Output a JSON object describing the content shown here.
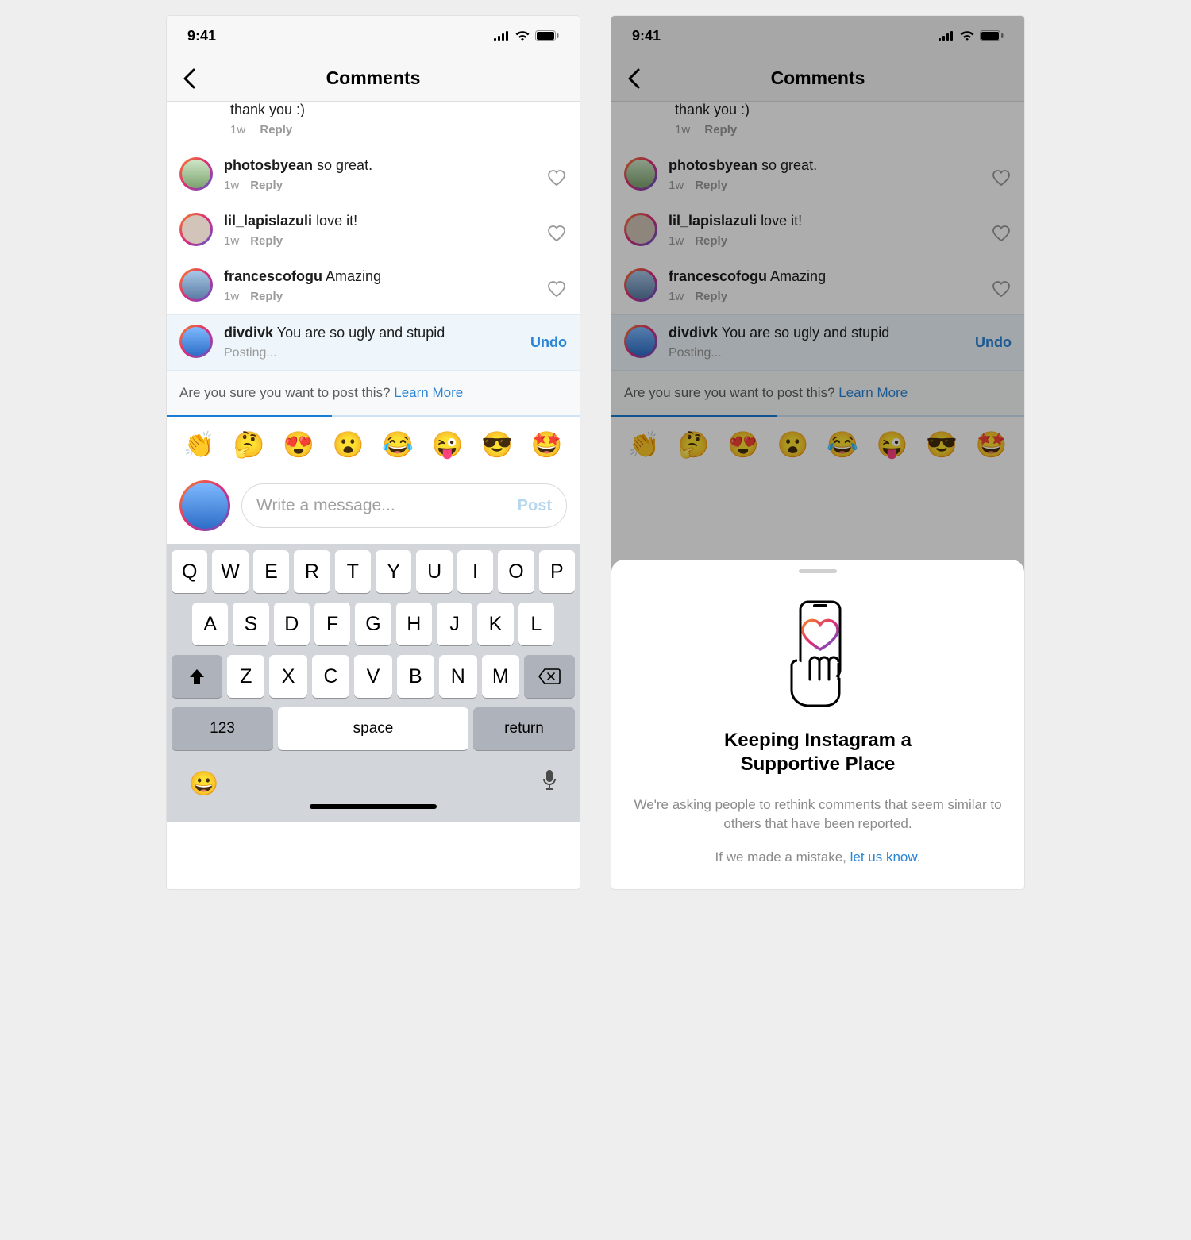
{
  "status": {
    "time": "9:41"
  },
  "nav": {
    "title": "Comments"
  },
  "partial": {
    "text": "thank you :)",
    "time": "1w",
    "reply": "Reply"
  },
  "comments": [
    {
      "username": "photosbyean",
      "text": "so great.",
      "time": "1w",
      "reply": "Reply",
      "avatar": "green"
    },
    {
      "username": "lil_lapislazuli",
      "text": "love it!",
      "time": "1w",
      "reply": "Reply",
      "avatar": "default"
    },
    {
      "username": "francescofogu",
      "text": "Amazing",
      "time": "1w",
      "reply": "Reply",
      "avatar": "sky"
    }
  ],
  "pending": {
    "username": "divdivk",
    "text": "You are so ugly and stupid",
    "posting": "Posting...",
    "undo": "Undo",
    "avatar": "blue"
  },
  "warning": {
    "question": "Are you sure you want to post this? ",
    "learn": "Learn More"
  },
  "emojis": [
    "👏",
    "🤔",
    "😍",
    "😮",
    "😂",
    "😜",
    "😎",
    "🤩"
  ],
  "composer": {
    "placeholder": "Write a message...",
    "post": "Post"
  },
  "keyboard": {
    "row1": [
      "Q",
      "W",
      "E",
      "R",
      "T",
      "Y",
      "U",
      "I",
      "O",
      "P"
    ],
    "row2": [
      "A",
      "S",
      "D",
      "F",
      "G",
      "H",
      "J",
      "K",
      "L"
    ],
    "row3": [
      "Z",
      "X",
      "C",
      "V",
      "B",
      "N",
      "M"
    ],
    "num": "123",
    "space": "space",
    "return": "return"
  },
  "sheet": {
    "title_line1": "Keeping Instagram a",
    "title_line2": "Supportive Place",
    "desc": "We're asking people to rethink comments that seem similar to others that have been reported.",
    "mistake_prefix": "If we made a mistake, ",
    "mistake_link": "let us know."
  }
}
